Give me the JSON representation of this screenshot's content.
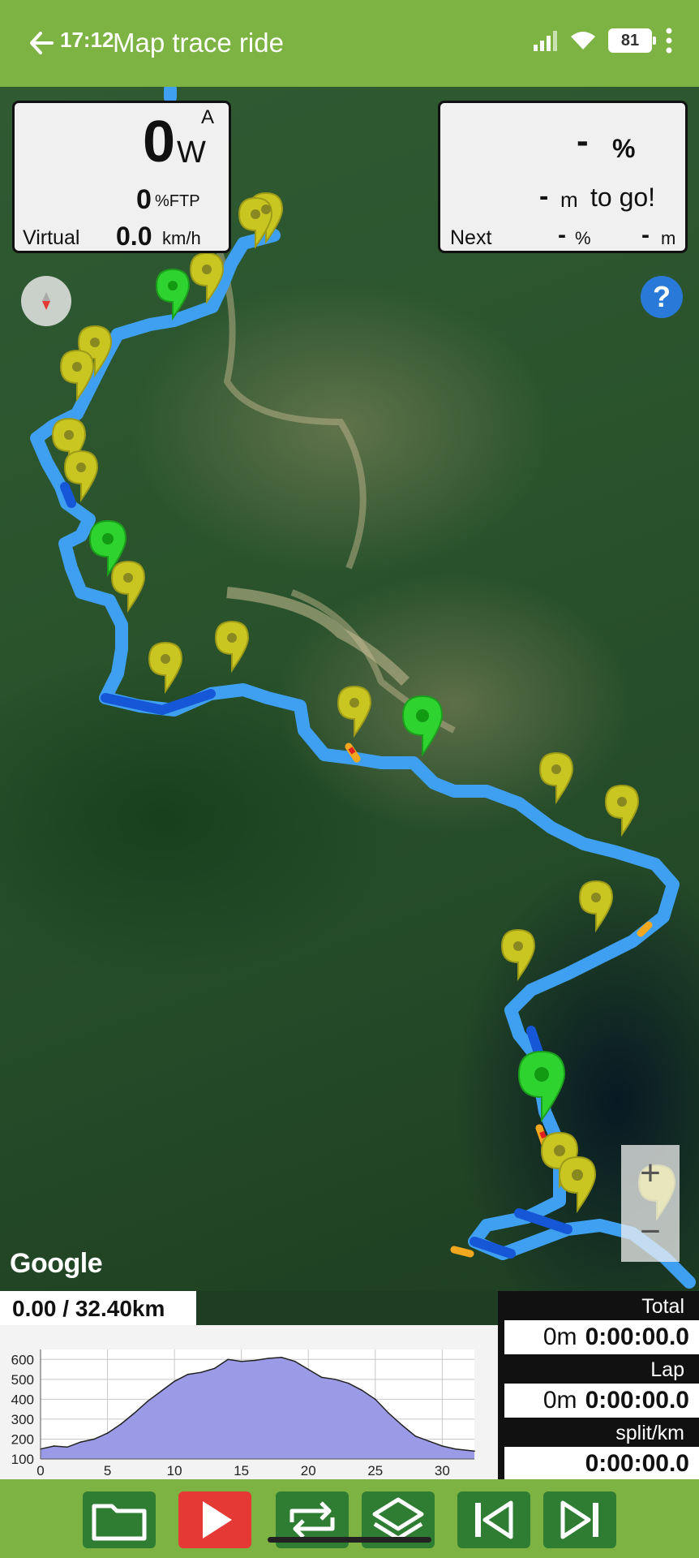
{
  "status": {
    "time": "17:12",
    "battery": "81"
  },
  "app": {
    "title": "Map trace ride"
  },
  "power_panel": {
    "watts": "0",
    "watts_unit": "W",
    "mode": "A",
    "ftp_value": "0",
    "ftp_unit": "%FTP",
    "source_label": "Virtual",
    "speed": "0.0",
    "speed_unit": "km/h"
  },
  "grade_panel": {
    "grade": "-",
    "grade_unit": "%",
    "dist_to_go": "-",
    "dist_unit": "m",
    "to_go_label": "to go!",
    "next_label": "Next",
    "next_grade": "-",
    "next_grade_unit": "%",
    "next_dist": "-",
    "next_dist_unit": "m"
  },
  "map": {
    "attribution": "Google",
    "zoom_in": "+",
    "zoom_out": "−",
    "help": "?"
  },
  "distance_readout": "0.00 / 32.40km",
  "stats": {
    "total_label": "Total",
    "total_dist": "0m",
    "total_time": "0:00:00.0",
    "lap_label": "Lap",
    "lap_dist": "0m",
    "lap_time": "0:00:00.0",
    "split_label": "split/km",
    "split_time": "0:00:00.0"
  },
  "chart_data": {
    "type": "area",
    "x_ticks": [
      "0",
      "5",
      "10",
      "15",
      "20",
      "25",
      "30"
    ],
    "y_ticks": [
      "100",
      "200",
      "300",
      "400",
      "500",
      "600"
    ],
    "xlim": [
      0,
      32.4
    ],
    "ylim": [
      100,
      650
    ],
    "x": [
      0,
      1,
      2,
      3,
      4,
      5,
      6,
      7,
      8,
      9,
      10,
      11,
      12,
      13,
      14,
      15,
      16,
      17,
      18,
      19,
      20,
      21,
      22,
      23,
      24,
      25,
      26,
      27,
      28,
      29,
      30,
      31,
      32.4
    ],
    "y": [
      150,
      165,
      160,
      185,
      200,
      230,
      275,
      330,
      390,
      440,
      490,
      525,
      535,
      555,
      600,
      590,
      595,
      605,
      610,
      590,
      550,
      510,
      500,
      480,
      445,
      400,
      330,
      270,
      215,
      190,
      165,
      150,
      140
    ],
    "fill_color": "#9a9ae6",
    "line_color": "#222222",
    "grid": true
  },
  "colors": {
    "bar": "#7cb342",
    "button": "#2e7d32",
    "play": "#e53935"
  },
  "toolbar_icons": [
    "folder-icon",
    "play-icon",
    "repeat-icon",
    "layers-icon",
    "skip-previous-icon",
    "skip-next-icon"
  ]
}
